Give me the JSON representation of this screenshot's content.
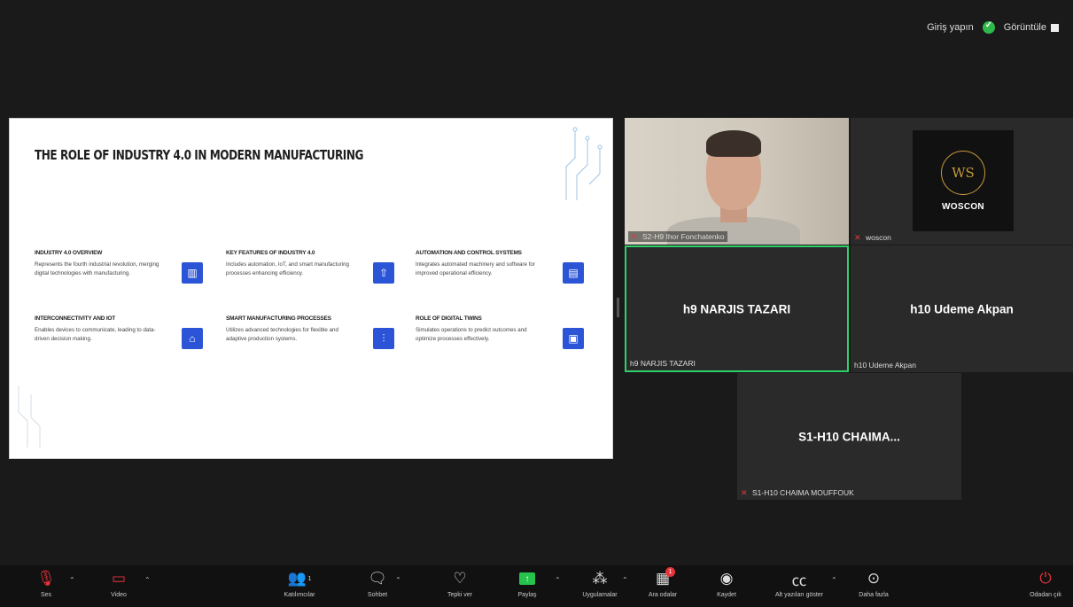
{
  "top": {
    "login_label": "Giriş yapın",
    "view_label": "Görüntüle"
  },
  "slide": {
    "title": "THE ROLE OF INDUSTRY 4.0 IN MODERN MANUFACTURING",
    "features": [
      {
        "heading": "INDUSTRY 4.0 OVERVIEW",
        "text": "Represents the fourth industrial revolution, merging digital technologies with manufacturing.",
        "icon": "factory-icon"
      },
      {
        "heading": "KEY FEATURES OF INDUSTRY 4.0",
        "text": "Includes automation, IoT, and smart manufacturing processes enhancing efficiency.",
        "icon": "factory-arrow-icon"
      },
      {
        "heading": "AUTOMATION AND CONTROL SYSTEMS",
        "text": "Integrates automated machinery and software for improved operational efficiency.",
        "icon": "control-system-icon"
      },
      {
        "heading": "INTERCONNECTIVITY AND IOT",
        "text": "Enables devices to communicate, leading to data-driven decision making.",
        "icon": "network-icon"
      },
      {
        "heading": "SMART MANUFACTURING PROCESSES",
        "text": "Utilizes advanced technologies for flexible and adaptive production systems.",
        "icon": "production-line-icon"
      },
      {
        "heading": "ROLE OF DIGITAL TWINS",
        "text": "Simulates operations to predict outcomes and optimize processes effectively.",
        "icon": "digital-twin-icon"
      }
    ]
  },
  "participants": {
    "camera_tile_label": "S2-H9 Ihor Fonchatenko",
    "logo_tile_label": "woscon",
    "logo_text": "WOSCON",
    "logo_mark": "WS",
    "narjis_center": "h9 NARJIS TAZARI",
    "narjis_label": "h9 NARJIS TAZARI",
    "udeme_center": "h10 Udeme Akpan",
    "udeme_label": "h10 Udeme Akpan",
    "chaima_center": "S1-H10  CHAIMA...",
    "chaima_label": "S1-H10 CHAIMA MOUFFOUK"
  },
  "toolbar": {
    "audio": "Ses",
    "video": "Video",
    "participants": "Katılımcılar",
    "participants_count": "1",
    "chat": "Sohbet",
    "react": "Tepki ver",
    "share": "Paylaş",
    "apps": "Uygulamalar",
    "breakout": "Ara odalar",
    "breakout_badge": "1",
    "record": "Kaydet",
    "captions": "Alt yazıları göster",
    "more": "Daha fazla",
    "leave": "Odadan çık"
  }
}
